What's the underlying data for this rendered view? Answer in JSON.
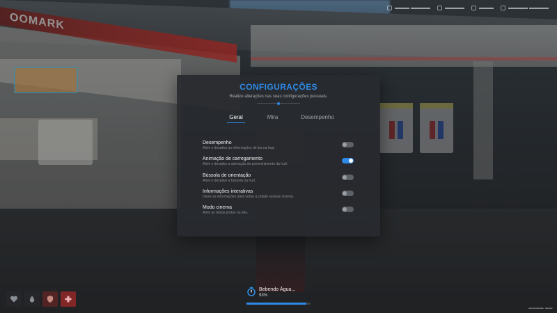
{
  "settings": {
    "title": "CONFIGURAÇÕES",
    "subtitle": "Realize alterações nas suas configurações pessoais.",
    "tabs": [
      {
        "label": "Geral",
        "active": true
      },
      {
        "label": "Mira",
        "active": false
      },
      {
        "label": "Desempenho",
        "active": false
      }
    ],
    "options": [
      {
        "label": "Desempenho",
        "description": "Ative e desative as informações de fps na hud.",
        "enabled": false
      },
      {
        "label": "Animação de carregamento",
        "description": "Ative e desative a animação de preenchimento da hud.",
        "enabled": true
      },
      {
        "label": "Bússola de orientação",
        "description": "Ative e desative a bússola na hud.",
        "enabled": false
      },
      {
        "label": "Informações interativas",
        "description": "Deixe as informações úteis sobre a cidade sempre visíveis.",
        "enabled": false
      },
      {
        "label": "Modo cinema",
        "description": "Ative as faixas pretas na tela.",
        "enabled": false
      }
    ]
  },
  "brand_sign": "OOMARK",
  "action_progress": {
    "label": "Bebendo Água...",
    "value_text": "93%",
    "fraction": 0.93
  },
  "quickbar": [
    {
      "icon": "heart-icon",
      "status": "neutral"
    },
    {
      "icon": "drop-icon",
      "status": "neutral"
    },
    {
      "icon": "shield-icon",
      "status": "armor"
    },
    {
      "icon": "health-icon",
      "status": "health"
    }
  ],
  "colors": {
    "accent": "#2e8ae6",
    "panel": "#282a2e",
    "toggle_off": "#5d6065"
  }
}
